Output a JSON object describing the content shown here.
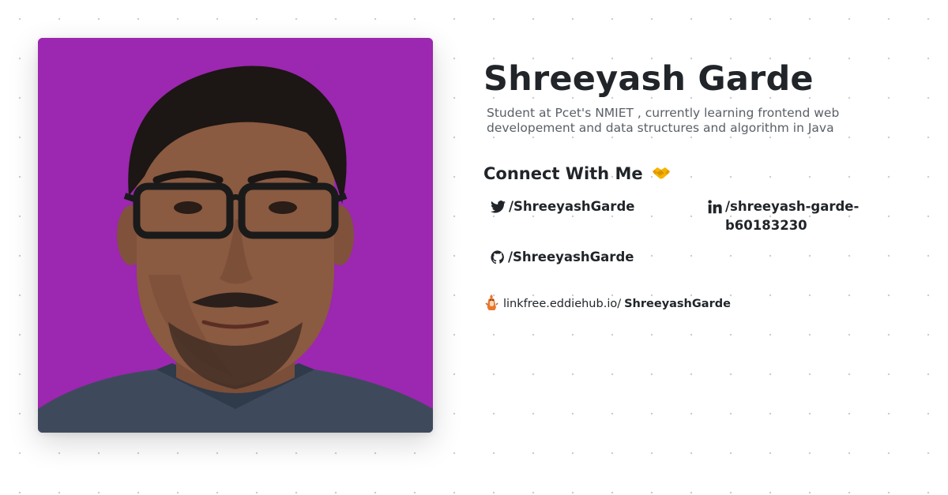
{
  "profile": {
    "name": "Shreeyash Garde",
    "bio": "Student at Pcet's NMIET , currently learning frontend web developement and data structures and algorithm in Java",
    "photo_background_color": "#9c27b0"
  },
  "connect": {
    "heading": "Connect With Me",
    "heading_icon": "handshake-icon",
    "links": [
      {
        "icon": "twitter-icon",
        "label": "/ShreeyashGarde"
      },
      {
        "icon": "linkedin-icon",
        "label": "/shreeyash-garde-b60183230"
      },
      {
        "icon": "github-icon",
        "label": "/ShreeyashGarde"
      }
    ]
  },
  "footer": {
    "icon": "linkfree-logo-icon",
    "domain": "linkfree.eddiehub.io/",
    "username": "ShreeyashGarde"
  }
}
